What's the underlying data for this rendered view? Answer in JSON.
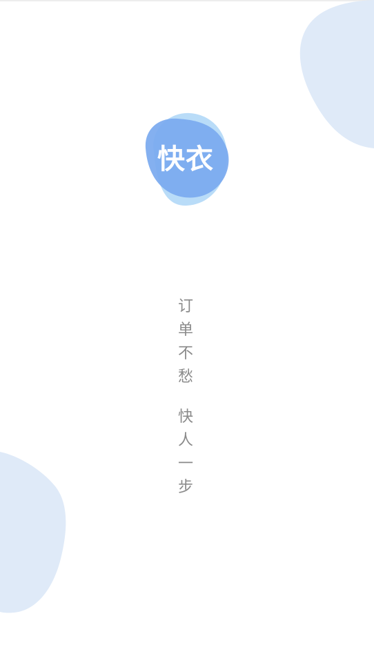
{
  "colors": {
    "background": "#ffffff",
    "blob": "#dfeaf8",
    "logo_primary": "#7aa9ef",
    "logo_secondary": "#b9dcf8",
    "slogan_text": "#8a8a8a"
  },
  "logo": {
    "text": "快衣",
    "icon": "app-logo-blob"
  },
  "slogan": {
    "line1": [
      "订",
      "单",
      "不",
      "愁"
    ],
    "line2": [
      "快",
      "人",
      "一",
      "步"
    ]
  }
}
